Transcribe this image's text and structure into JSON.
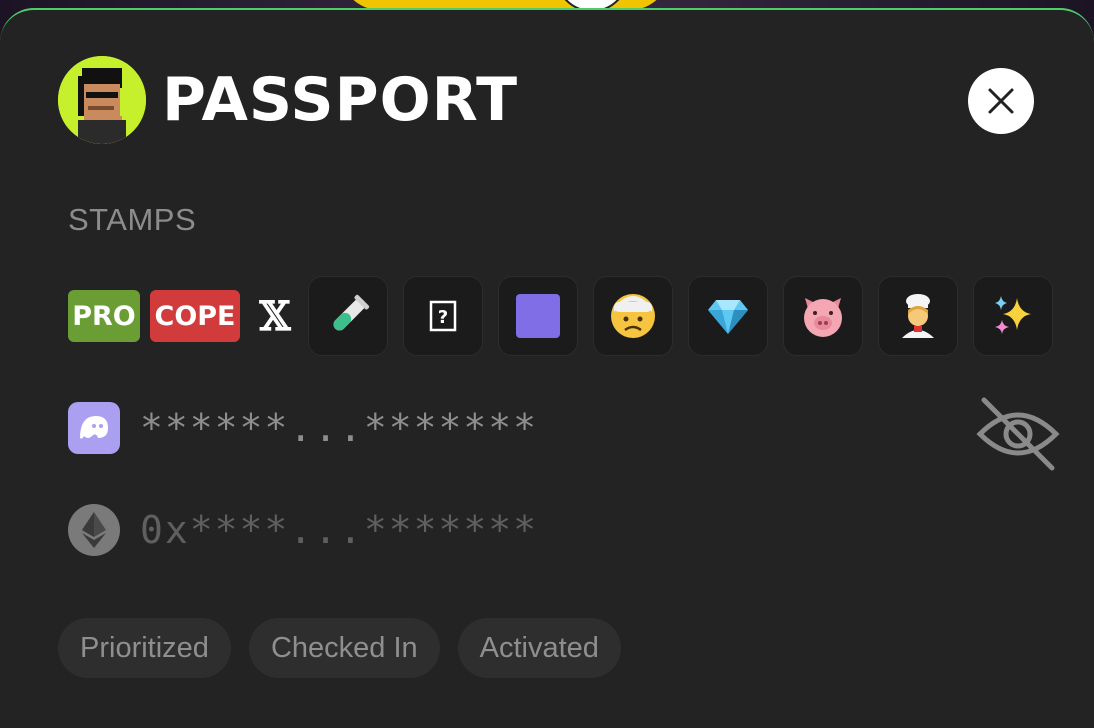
{
  "header": {
    "title": "PASSPORT",
    "close_icon": "close-icon"
  },
  "stamps": {
    "label": "STAMPS",
    "badges": [
      {
        "label": "PRO",
        "color": "#6a9e35"
      },
      {
        "label": "COPE",
        "color": "#d13b3b"
      }
    ],
    "x_logo": "𝕏",
    "icons": [
      {
        "name": "test-tube-icon",
        "glyph": "🧪"
      },
      {
        "name": "unknown-box-icon",
        "glyph": "⍰"
      },
      {
        "name": "purple-square-icon",
        "glyph": "🟪"
      },
      {
        "name": "bandaged-face-icon",
        "glyph": "🤕"
      },
      {
        "name": "gem-icon",
        "glyph": "💎"
      },
      {
        "name": "pig-face-icon",
        "glyph": "🐷"
      },
      {
        "name": "cook-icon",
        "glyph": "🧑‍🍳"
      },
      {
        "name": "sparkles-icon",
        "glyph": "✨"
      }
    ]
  },
  "addresses": {
    "phantom": "******...*******",
    "ethereum": "0x****...*******"
  },
  "tags": [
    "Prioritized",
    "Checked In",
    "Activated"
  ],
  "colors": {
    "card_bg": "#232323",
    "accent_green": "#4ccf6a",
    "avatar_bg": "#c7f02c",
    "phantom_bg": "#ab9ff2"
  }
}
